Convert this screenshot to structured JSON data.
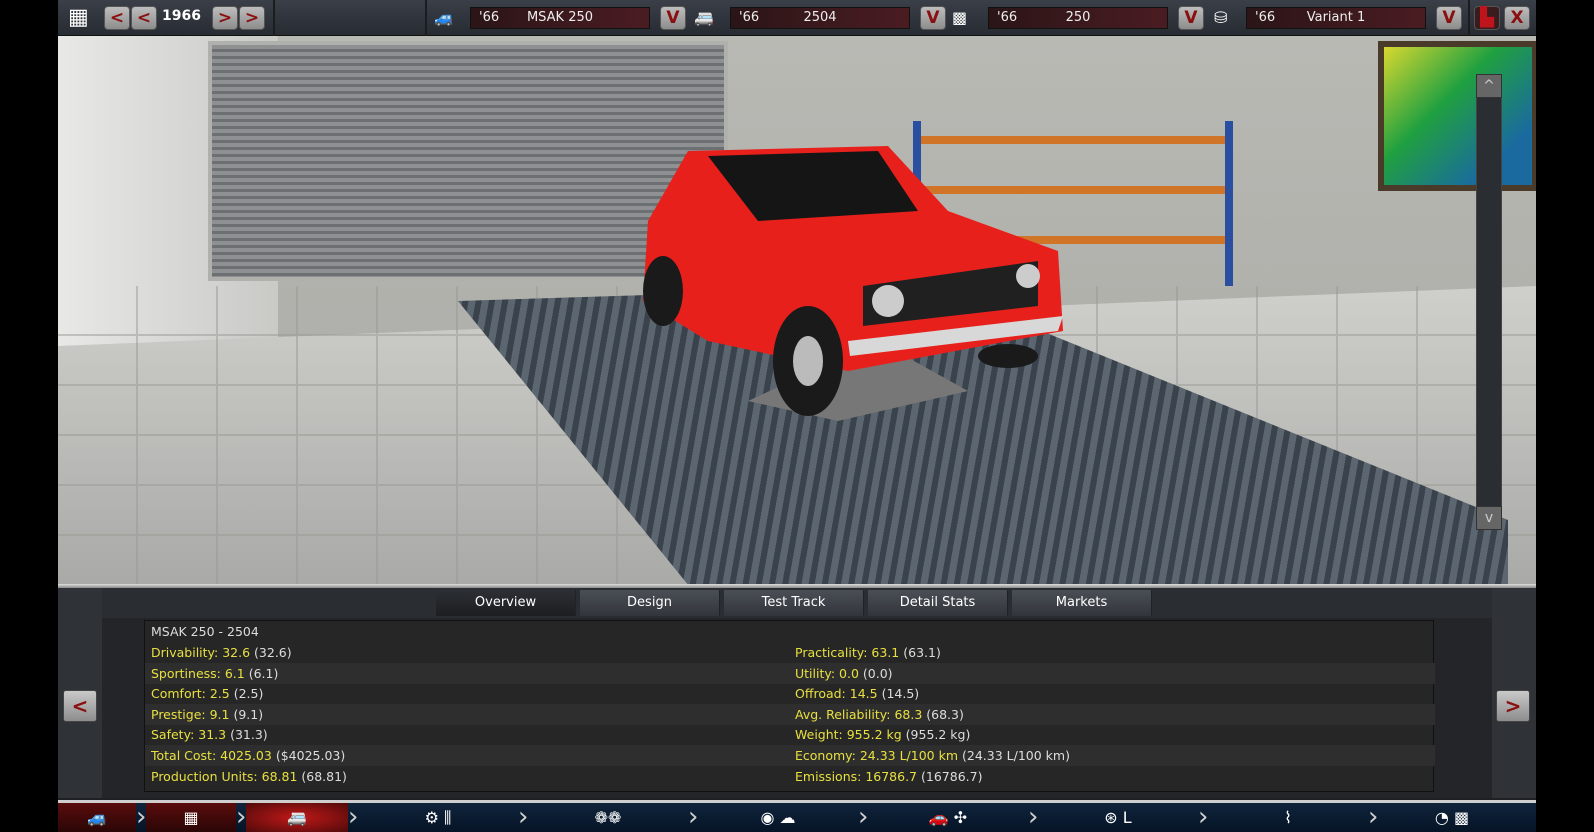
{
  "topbar": {
    "year": "1966",
    "prev_label": "<",
    "next_label": ">",
    "dropdown_label": "V",
    "selectors": [
      {
        "name": "model",
        "year": "'66",
        "value": "MSAK 250",
        "icon": "car-icon"
      },
      {
        "name": "trim",
        "year": "'66",
        "value": "2504",
        "icon": "car-body-icon"
      },
      {
        "name": "engine",
        "year": "'66",
        "value": "250",
        "icon": "engine-block-icon"
      },
      {
        "name": "variant",
        "year": "'66",
        "value": "Variant 1",
        "icon": "piston-icon"
      }
    ],
    "close_label": "X"
  },
  "viewport": {
    "scroll_up": "^",
    "scroll_down": "v"
  },
  "tabs": [
    {
      "label": "Overview",
      "active": true
    },
    {
      "label": "Design"
    },
    {
      "label": "Test Track"
    },
    {
      "label": "Detail Stats"
    },
    {
      "label": "Markets"
    }
  ],
  "stats": {
    "title": "MSAK 250 - 2504",
    "left": [
      {
        "key": "Drivability: 32.6",
        "paren": "(32.6)"
      },
      {
        "key": "Sportiness: 6.1",
        "paren": "(6.1)"
      },
      {
        "key": "Comfort: 2.5",
        "paren": "(2.5)"
      },
      {
        "key": "Prestige: 9.1",
        "paren": "(9.1)"
      },
      {
        "key": "Safety: 31.3",
        "paren": "(31.3)"
      },
      {
        "key": "Total Cost: 4025.03",
        "paren": "($4025.03)"
      },
      {
        "key": "Production Units: 68.81",
        "paren": "(68.81)"
      }
    ],
    "right": [
      {
        "key": "Practicality: 63.1",
        "paren": "(63.1)"
      },
      {
        "key": "Utility: 0.0",
        "paren": "(0.0)"
      },
      {
        "key": "Offroad: 14.5",
        "paren": "(14.5)"
      },
      {
        "key": "Avg. Reliability: 68.3",
        "paren": "(68.3)"
      },
      {
        "key": "Weight: 955.2 kg",
        "paren": "(955.2 kg)"
      },
      {
        "key": "Economy: 24.33 L/100 km",
        "paren": "(24.33 L/100 km)"
      },
      {
        "key": "Emissions: 16786.7",
        "paren": "(16786.7)"
      }
    ],
    "prev_label": "<",
    "next_label": ">"
  },
  "bottom_nav": [
    {
      "name": "car-model",
      "icon": "🚙"
    },
    {
      "name": "engine",
      "icon": "▦"
    },
    {
      "name": "trim",
      "icon": "🚐",
      "active": true
    },
    {
      "name": "chassis",
      "icon": "⚙ ⫼"
    },
    {
      "name": "wheels",
      "icon": "❁❁"
    },
    {
      "name": "brakes-body",
      "icon": "◉ ☁"
    },
    {
      "name": "aero-cooling",
      "icon": "🚗 ✣"
    },
    {
      "name": "interior",
      "icon": "⊛ L"
    },
    {
      "name": "suspension",
      "icon": "⌇"
    },
    {
      "name": "test-finish",
      "icon": "◔ ▩"
    }
  ],
  "colors": {
    "accent": "#8a1010",
    "stat_key": "#e8e040",
    "active_nav": "#b01010"
  }
}
